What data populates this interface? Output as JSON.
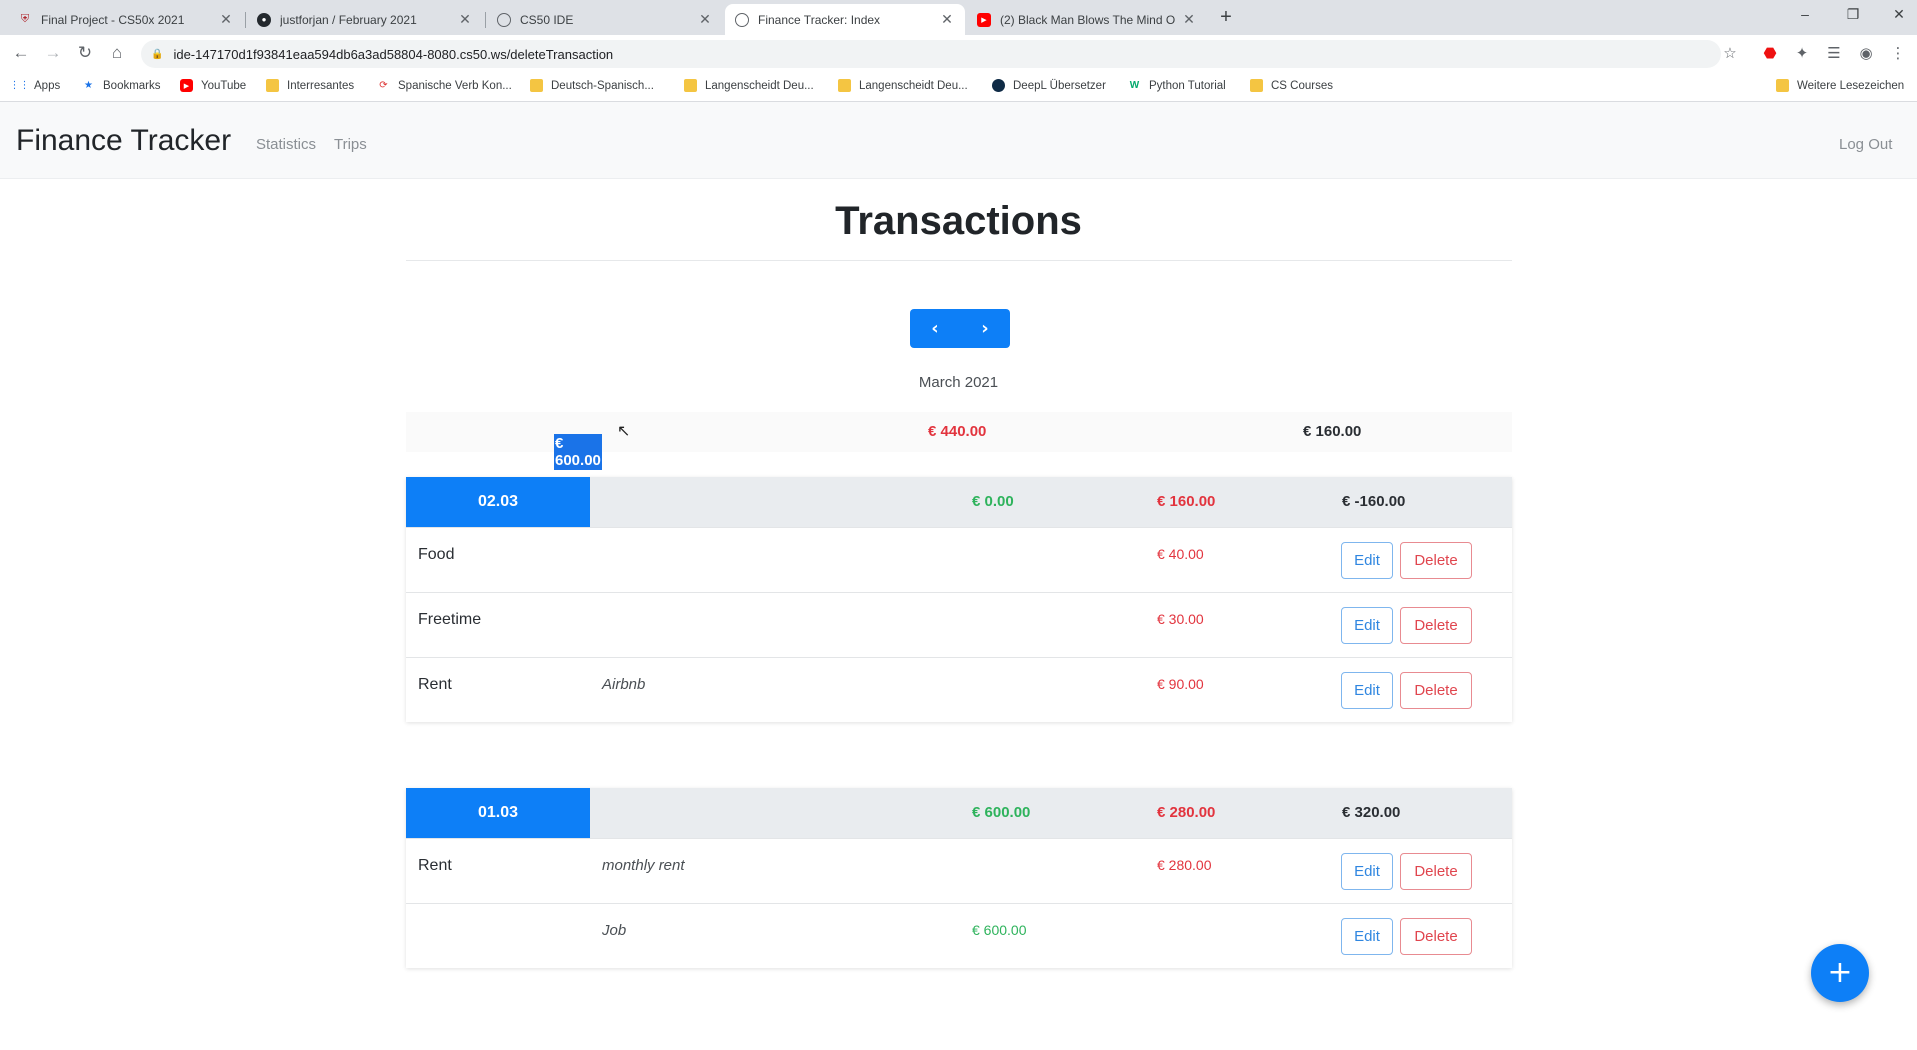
{
  "browser": {
    "tabs": [
      {
        "title": "Final Project - CS50x 2021",
        "icon": "shield-icon"
      },
      {
        "title": "justforjan / February 2021",
        "icon": "github-icon"
      },
      {
        "title": "CS50 IDE",
        "icon": "globe-icon"
      },
      {
        "title": "Finance Tracker: Index",
        "icon": "globe-icon",
        "active": true
      },
      {
        "title": "(2) Black Man Blows The Mind O",
        "icon": "youtube-icon"
      }
    ],
    "url": "ide-147170d1f93841eaa594db6a3ad58804-8080.cs50.ws/deleteTransaction",
    "bookmarks": [
      {
        "label": "Apps",
        "icon": "apps-grid-icon"
      },
      {
        "label": "Bookmarks",
        "icon": "star-icon"
      },
      {
        "label": "YouTube",
        "icon": "youtube-icon"
      },
      {
        "label": "Interresantes",
        "icon": "folder-icon"
      },
      {
        "label": "Spanische Verb Kon...",
        "icon": "site-icon"
      },
      {
        "label": "Deutsch-Spanisch...",
        "icon": "folder-icon"
      },
      {
        "label": "Langenscheidt Deu...",
        "icon": "langenscheidt-icon"
      },
      {
        "label": "Langenscheidt Deu...",
        "icon": "langenscheidt-icon"
      },
      {
        "label": "DeepL Übersetzer",
        "icon": "deepl-icon"
      },
      {
        "label": "Python Tutorial",
        "icon": "w3-icon"
      },
      {
        "label": "CS Courses",
        "icon": "folder-icon"
      },
      {
        "label": "Weitere Lesezeichen",
        "icon": "folder-icon"
      }
    ]
  },
  "navbar": {
    "brand": "Finance Tracker",
    "links": [
      "Statistics",
      "Trips"
    ],
    "logout": "Log Out"
  },
  "main": {
    "title": "Transactions",
    "month": "March 2021",
    "summary": {
      "income": "€ 600.00",
      "expenses": "€ 440.00",
      "balance": "€ 160.00"
    }
  },
  "days": [
    {
      "date": "02.03",
      "income": "€ 0.00",
      "expenses": "€ 160.00",
      "balance": "€ -160.00",
      "transactions": [
        {
          "category": "Food",
          "note": "",
          "amount": "€ 40.00",
          "type": "expense"
        },
        {
          "category": "Freetime",
          "note": "",
          "amount": "€ 30.00",
          "type": "expense"
        },
        {
          "category": "Rent",
          "note": "Airbnb",
          "amount": "€ 90.00",
          "type": "expense"
        }
      ]
    },
    {
      "date": "01.03",
      "income": "€ 600.00",
      "expenses": "€ 280.00",
      "balance": "€ 320.00",
      "transactions": [
        {
          "category": "Rent",
          "note": "monthly rent",
          "amount": "€ 280.00",
          "type": "expense"
        },
        {
          "category": "",
          "note": "Job",
          "amount": "€ 600.00",
          "type": "income"
        }
      ]
    }
  ],
  "buttons": {
    "edit": "Edit",
    "delete": "Delete",
    "add": "+",
    "prev": "‹",
    "next": "›"
  },
  "colors": {
    "primary": "#0d7ff7",
    "income": "#2eb35c",
    "expense": "#e2343e"
  }
}
